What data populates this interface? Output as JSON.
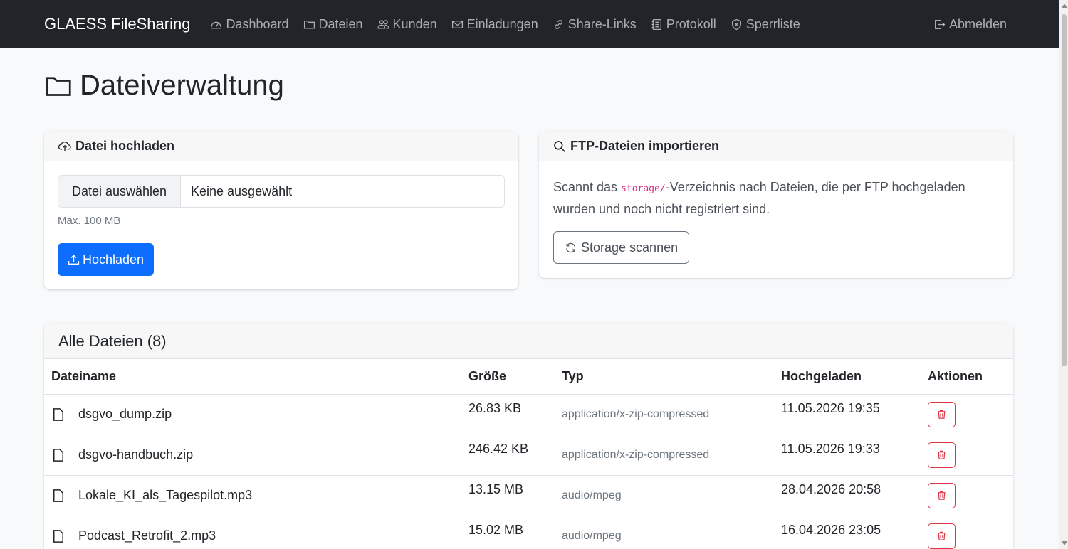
{
  "navbar": {
    "brand": "GLAESS FileSharing",
    "items": [
      {
        "label": "Dashboard",
        "icon": "speedometer-icon"
      },
      {
        "label": "Dateien",
        "icon": "folder-icon"
      },
      {
        "label": "Kunden",
        "icon": "people-icon"
      },
      {
        "label": "Einladungen",
        "icon": "envelope-icon"
      },
      {
        "label": "Share-Links",
        "icon": "link-icon"
      },
      {
        "label": "Protokoll",
        "icon": "journal-icon"
      },
      {
        "label": "Sperrliste",
        "icon": "shield-x-icon"
      }
    ],
    "logout": "Abmelden"
  },
  "page": {
    "title": "Dateiverwaltung"
  },
  "upload": {
    "header": "Datei hochladen",
    "file_button": "Datei auswählen",
    "file_status": "Keine ausgewählt",
    "help": "Max. 100 MB",
    "submit": "Hochladen"
  },
  "ftp": {
    "header": "FTP-Dateien importieren",
    "text_before": "Scannt das ",
    "code": "storage/",
    "text_after": "-Verzeichnis nach Dateien, die per FTP hochgeladen wurden und noch nicht registriert sind.",
    "button": "Storage scannen"
  },
  "files": {
    "title": "Alle Dateien (8)",
    "columns": [
      "Dateiname",
      "Größe",
      "Typ",
      "Hochgeladen",
      "Aktionen"
    ],
    "rows": [
      {
        "name": "dsgvo_dump.zip",
        "size": "26.83 KB",
        "type": "application/x-zip-compressed",
        "uploaded": "11.05.2026 19:35"
      },
      {
        "name": "dsgvo-handbuch.zip",
        "size": "246.42 KB",
        "type": "application/x-zip-compressed",
        "uploaded": "11.05.2026 19:33"
      },
      {
        "name": "Lokale_KI_als_Tagespilot.mp3",
        "size": "13.15 MB",
        "type": "audio/mpeg",
        "uploaded": "28.04.2026 20:58"
      },
      {
        "name": "Podcast_Retrofit_2.mp3",
        "size": "15.02 MB",
        "type": "audio/mpeg",
        "uploaded": "16.04.2026 23:05"
      }
    ]
  },
  "colors": {
    "navbar": "#212529",
    "primary": "#0d6efd",
    "danger": "#dc3545",
    "code": "#d63384"
  }
}
